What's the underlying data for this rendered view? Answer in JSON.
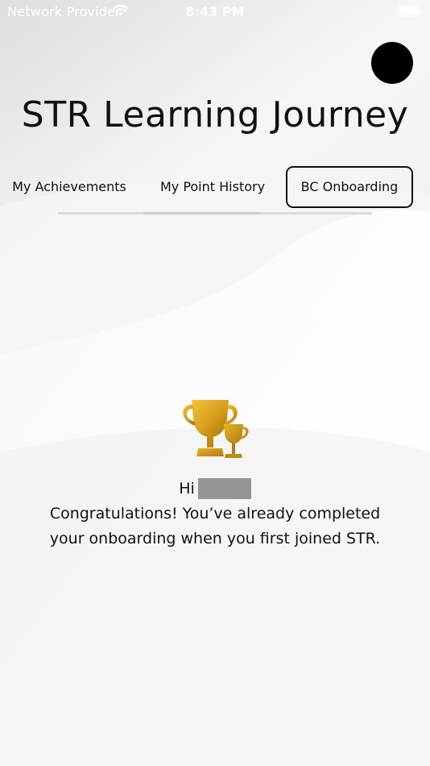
{
  "status_bar": {
    "carrier": "Network Provider",
    "time": "8:43 PM",
    "wifi_icon": "wifi-icon",
    "battery_icon": "battery-icon"
  },
  "header": {
    "title": "STR Learning Journey",
    "avatar_icon": "avatar"
  },
  "tabs": [
    {
      "label": "My Achievements",
      "active": false
    },
    {
      "label": "My Point History",
      "active": false
    },
    {
      "label": "BC Onboarding",
      "active": true
    }
  ],
  "content": {
    "trophy_icon": "trophy-icon",
    "greeting": "Hi",
    "message": "Congratulations! You’ve already completed your onboarding when you first joined STR."
  },
  "colors": {
    "background": "#f2f2f2",
    "text": "#111111",
    "trophy_gold": "#d9a21f",
    "redaction": "#959595"
  }
}
